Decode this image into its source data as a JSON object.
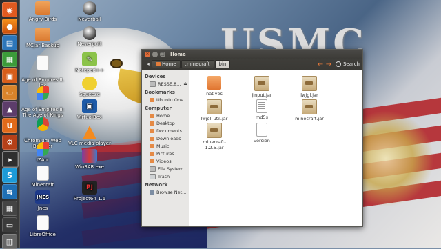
{
  "desktop": {
    "icons_col1": [
      {
        "label": "Angry Birds",
        "icon": "folder-icon"
      },
      {
        "label": "MCJar Backup",
        "icon": "folder-icon"
      },
      {
        "label": "Age of Empires II.\nlnk",
        "icon": "document-icon"
      },
      {
        "label": "Age of Empires II:\nThe Age of Kings",
        "icon": "windows-icon"
      },
      {
        "label": "Chromium Web\nBrowser",
        "icon": "chromium-icon"
      },
      {
        "label": "IZArc",
        "icon": "windows-icon"
      },
      {
        "label": "Minecraft",
        "icon": "document-icon"
      },
      {
        "label": "Jnes",
        "icon": "jnes-icon"
      },
      {
        "label": "LibreOffice",
        "icon": "document-icon"
      }
    ],
    "icons_col2": [
      {
        "label": "Neverball",
        "icon": "ball-icon"
      },
      {
        "label": "Neverputt",
        "icon": "ball-icon"
      },
      {
        "label": "Notepad++",
        "icon": "notepad-icon"
      },
      {
        "label": "Squeeze",
        "icon": "squeeze-icon"
      },
      {
        "label": "VirtualBox",
        "icon": "virtualbox-icon"
      },
      {
        "label": "VLC media player",
        "icon": "vlc-icon"
      },
      {
        "label": "WinRAR.exe",
        "icon": "winrar-icon"
      },
      {
        "label": "Project64 1.6",
        "icon": "project64-icon"
      }
    ],
    "wallpaper_text": "USMC"
  },
  "window": {
    "title": "Home",
    "breadcrumbs": [
      {
        "label": "Home",
        "active": false
      },
      {
        "label": ".minecraft",
        "active": false
      },
      {
        "label": "bin",
        "active": true
      }
    ],
    "search_label": "Search",
    "sidebar": {
      "devices_heading": "Devices",
      "devices": [
        {
          "label": "RESSE,8..."
        }
      ],
      "bookmarks_heading": "Bookmarks",
      "bookmarks": [
        {
          "label": "Ubuntu One"
        }
      ],
      "computer_heading": "Computer",
      "computer": [
        {
          "label": "Home"
        },
        {
          "label": "Desktop"
        },
        {
          "label": "Documents"
        },
        {
          "label": "Downloads"
        },
        {
          "label": "Music"
        },
        {
          "label": "Pictures"
        },
        {
          "label": "Videos"
        },
        {
          "label": "File System"
        },
        {
          "label": "Trash"
        }
      ],
      "network_heading": "Network",
      "network": [
        {
          "label": "Browse Net..."
        }
      ]
    },
    "files": [
      {
        "name": "natives",
        "type": "folder"
      },
      {
        "name": "jinput.jar",
        "type": "jar"
      },
      {
        "name": "lwjgl.jar",
        "type": "jar"
      },
      {
        "name": "lwjgl_util.jar",
        "type": "jar"
      },
      {
        "name": "md5s",
        "type": "text"
      },
      {
        "name": "minecraft.jar",
        "type": "jar"
      },
      {
        "name": "minecraft-1.2.5.jar",
        "type": "jar"
      },
      {
        "name": "version",
        "type": "text"
      }
    ]
  },
  "colors": {
    "accent_orange": "#e5793a",
    "titlebar": "#3c3b37",
    "launcher": "#2b2b2b"
  }
}
